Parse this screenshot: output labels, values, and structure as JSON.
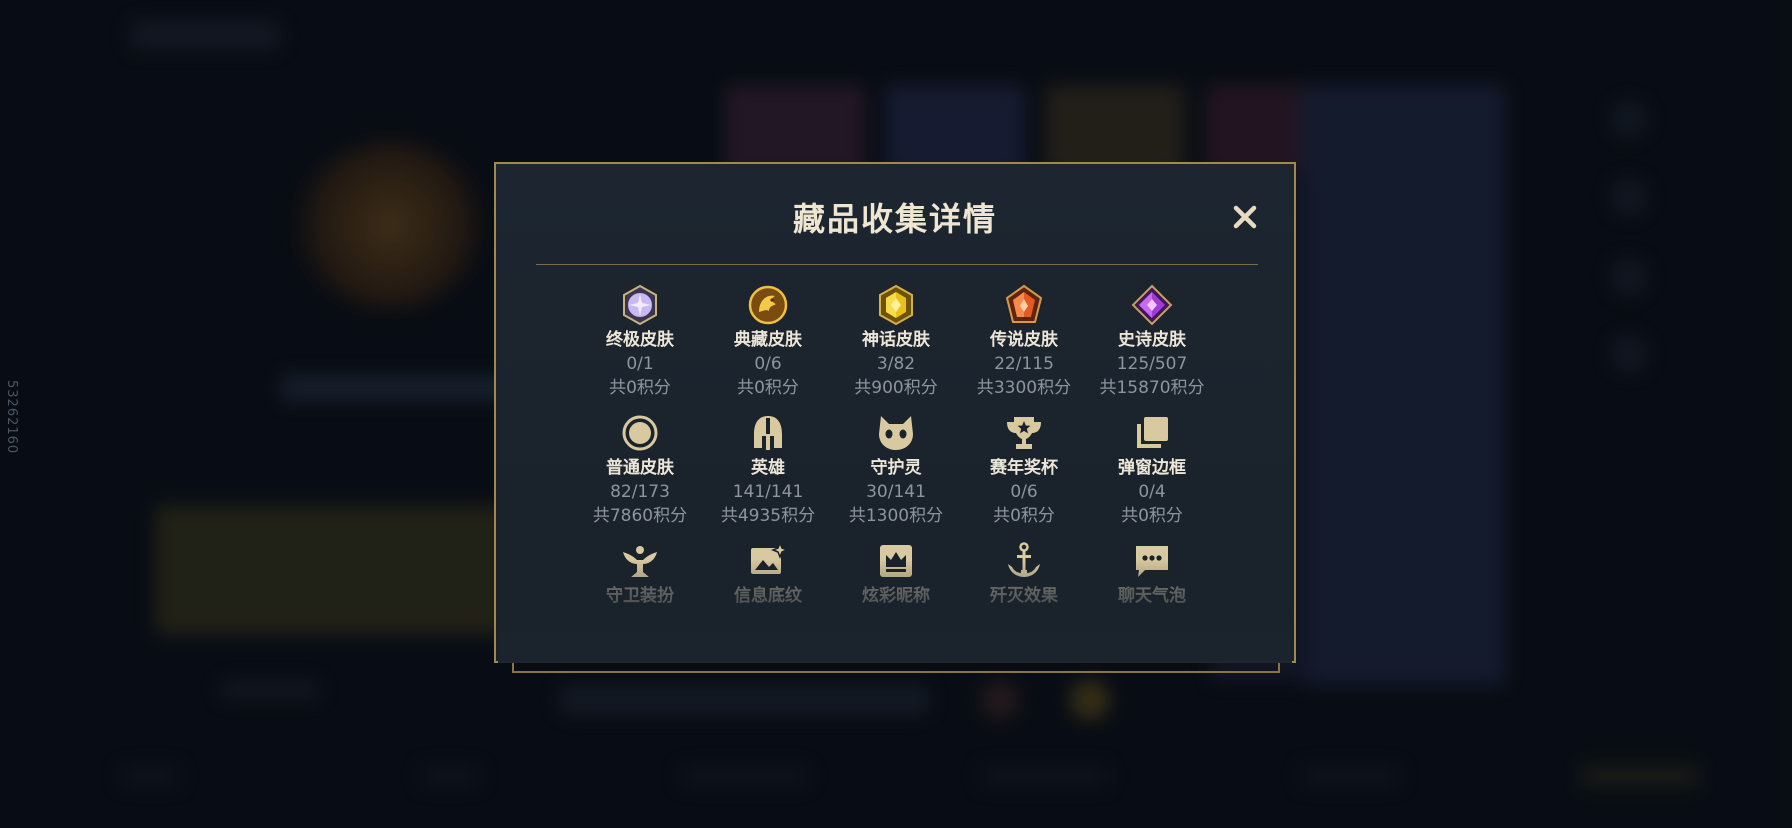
{
  "background": {
    "vertical_id": "53262160"
  },
  "modal": {
    "title": "藏品收集详情",
    "close_icon": "close-icon",
    "items": [
      {
        "name": "终极皮肤",
        "count": "0/1",
        "points": "共0积分",
        "icon": "ultimate-gem-icon",
        "color": "#c9b8f2"
      },
      {
        "name": "典藏皮肤",
        "count": "0/6",
        "points": "共0积分",
        "icon": "prestige-dragon-icon",
        "color": "#e3a92c"
      },
      {
        "name": "神话皮肤",
        "count": "3/82",
        "points": "共900积分",
        "icon": "mythic-gem-icon",
        "color": "#e8c21a"
      },
      {
        "name": "传说皮肤",
        "count": "22/115",
        "points": "共3300积分",
        "icon": "legendary-gem-icon",
        "color": "#e35a22"
      },
      {
        "name": "史诗皮肤",
        "count": "125/507",
        "points": "共15870积分",
        "icon": "epic-gem-icon",
        "color": "#a33ad6"
      },
      {
        "name": "普通皮肤",
        "count": "82/173",
        "points": "共7860积分",
        "icon": "standard-circle-icon",
        "color": "#d9c9a0"
      },
      {
        "name": "英雄",
        "count": "141/141",
        "points": "共4935积分",
        "icon": "champion-helmet-icon",
        "color": "#d9c9a0"
      },
      {
        "name": "守护灵",
        "count": "30/141",
        "points": "共1300积分",
        "icon": "guardian-creature-icon",
        "color": "#d9c9a0"
      },
      {
        "name": "赛年奖杯",
        "count": "0/6",
        "points": "共0积分",
        "icon": "trophy-icon",
        "color": "#d9c9a0"
      },
      {
        "name": "弹窗边框",
        "count": "0/4",
        "points": "共0积分",
        "icon": "frame-stack-icon",
        "color": "#d9c9a0"
      },
      {
        "name": "守卫装扮",
        "icon": "ward-skin-icon",
        "color": "#d9c9a0"
      },
      {
        "name": "信息底纹",
        "icon": "banner-image-icon",
        "color": "#d9c9a0"
      },
      {
        "name": "炫彩昵称",
        "icon": "crown-nameplate-icon",
        "color": "#d9c9a0"
      },
      {
        "name": "歼灭效果",
        "icon": "anchor-icon",
        "color": "#d9c9a0"
      },
      {
        "name": "聊天气泡",
        "icon": "chat-bubble-icon",
        "color": "#d9c9a0"
      }
    ]
  },
  "colors": {
    "accent_gold": "#a0894f",
    "title": "#efe6d2",
    "muted": "#8d949c"
  }
}
